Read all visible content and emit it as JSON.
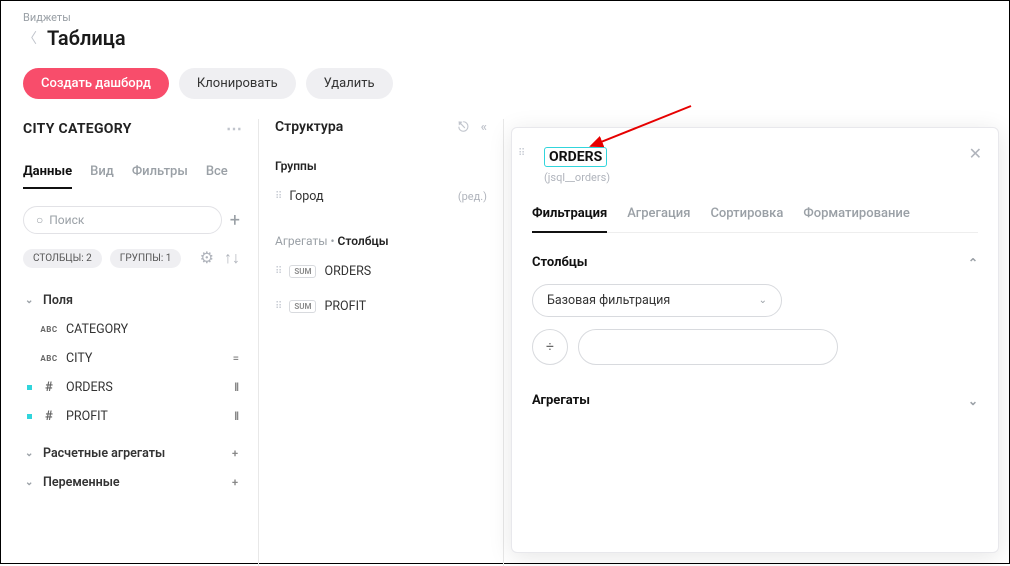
{
  "header": {
    "breadcrumb": "Виджеты",
    "title": "Таблица",
    "btn_primary": "Создать дашборд",
    "btn_clone": "Клонировать",
    "btn_delete": "Удалить"
  },
  "sidebar": {
    "source_name": "CITY CATEGORY",
    "tabs": [
      "Данные",
      "Вид",
      "Фильтры",
      "Все"
    ],
    "search_placeholder": "Поиск",
    "chip_cols": "СТОЛБЦЫ: 2",
    "chip_groups": "ГРУППЫ: 1",
    "sections": {
      "fields": "Поля",
      "calc": "Расчетные агрегаты",
      "vars": "Переменные"
    },
    "fields": [
      {
        "type": "ABC",
        "name": "CATEGORY",
        "marked": false,
        "tail": ""
      },
      {
        "type": "ABC",
        "name": "CITY",
        "marked": false,
        "tail": "="
      },
      {
        "type": "#",
        "name": "ORDERS",
        "marked": true,
        "tail": "ll"
      },
      {
        "type": "#",
        "name": "PROFIT",
        "marked": true,
        "tail": "ll"
      }
    ]
  },
  "structure": {
    "title": "Структура",
    "groups_label": "Группы",
    "group_item": "Город",
    "group_edit": "(ред.)",
    "agg_label": "Агрегаты",
    "col_label": "Столбцы",
    "sum_badge": "SUM",
    "agg_items": [
      "ORDERS",
      "PROFIT"
    ]
  },
  "panel": {
    "title": "ORDERS",
    "subtitle": "(jsql__orders)",
    "tabs": [
      "Фильтрация",
      "Агрегация",
      "Сортировка",
      "Форматирование"
    ],
    "sect_cols": "Столбцы",
    "select_value": "Базовая фильтрация",
    "op": "÷",
    "sect_agg": "Агрегаты"
  }
}
